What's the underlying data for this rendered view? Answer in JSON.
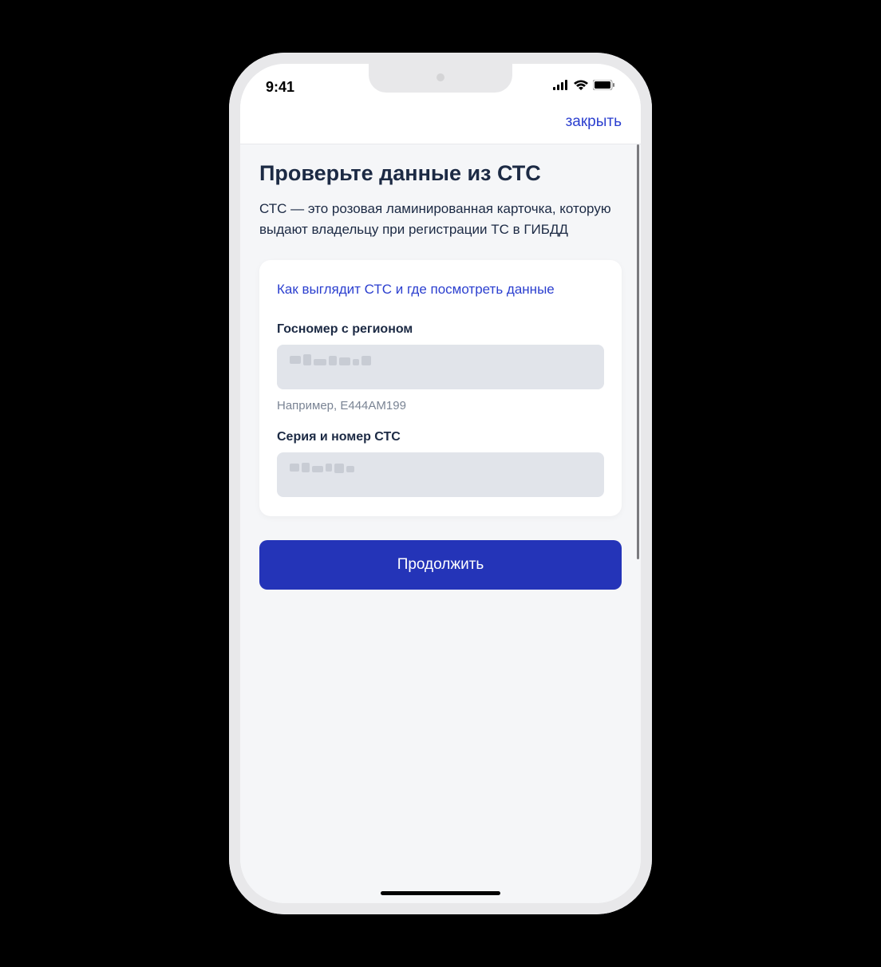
{
  "status_bar": {
    "time": "9:41"
  },
  "nav": {
    "close_label": "закрыть"
  },
  "page": {
    "title": "Проверьте данные из СТС",
    "description": "СТС — это розовая ламинированная карточка, которую выдают владельцу при регистрации ТС в ГИБДД"
  },
  "card": {
    "help_link": "Как выглядит СТС и где посмотреть данные",
    "fields": {
      "plate": {
        "label": "Госномер с регионом",
        "hint": "Например, Е444АМ199"
      },
      "sts": {
        "label": "Серия и номер СТС"
      }
    }
  },
  "actions": {
    "continue_label": "Продолжить"
  }
}
